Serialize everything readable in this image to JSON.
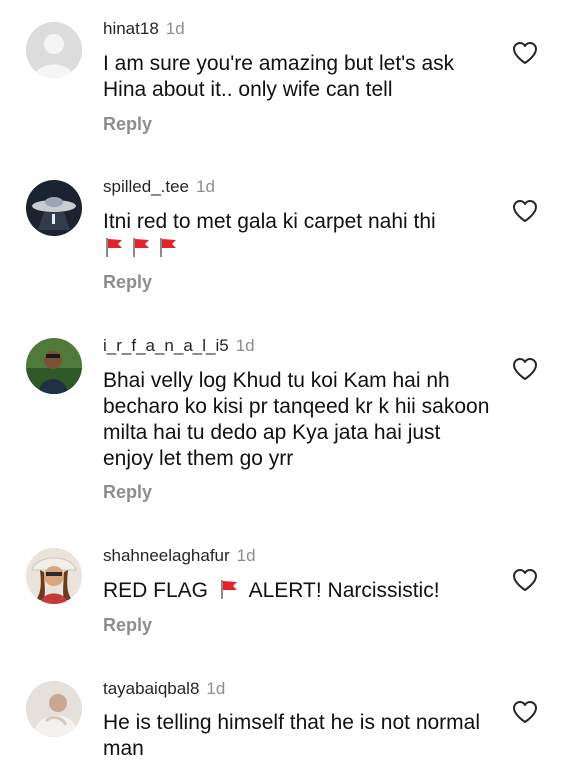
{
  "comments": [
    {
      "username": "hinat18",
      "time": "1d",
      "text": "I am sure you're amazing but let's ask Hina about it.. only wife can tell",
      "reply_label": "Reply"
    },
    {
      "username": "spilled_.tee",
      "time": "1d",
      "text": "Itni red to met gala ki carpet nahi thi",
      "reply_label": "Reply",
      "emoji": [
        "red-flag",
        "red-flag",
        "red-flag"
      ]
    },
    {
      "username": "i_r_f_a_n_a_l_i5",
      "time": "1d",
      "text": "Bhai velly log Khud tu koi Kam hai nh becharo ko kisi pr tanqeed kr k hii sakoon milta hai tu dedo ap Kya jata hai just enjoy let them go yrr",
      "reply_label": "Reply"
    },
    {
      "username": "shahneelaghafur",
      "time": "1d",
      "text_before_emoji": "RED FLAG",
      "text_after_emoji": "ALERT! Narcissistic!",
      "emoji": [
        "red-flag"
      ],
      "reply_label": "Reply"
    },
    {
      "username": "tayabaiqbal8",
      "time": "1d",
      "text": "He is telling himself that he is not normal man"
    }
  ],
  "icons": {
    "like": "heart-outline-icon",
    "flag": "red-flag-icon"
  },
  "colors": {
    "secondary_text": "#8e8e8e",
    "flag_red": "#e0242a"
  }
}
